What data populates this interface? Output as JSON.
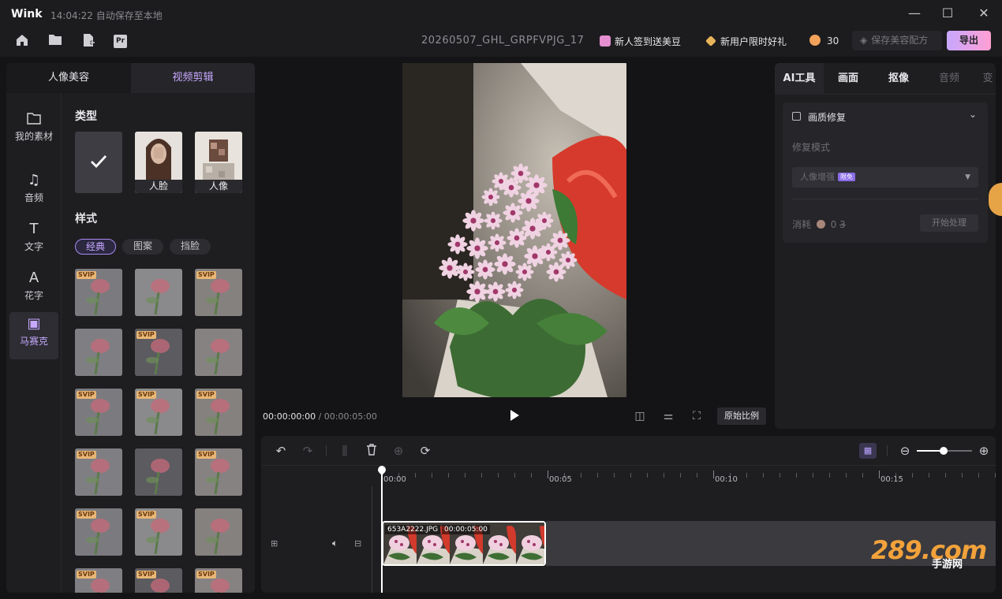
{
  "app": {
    "brand": "Wink",
    "save_status": "14:04:22 自动保存至本地",
    "file_name": "20260507_GHL_GRPFVPJG_17",
    "window": {
      "minimize": "—",
      "maximize": "☐",
      "close": "✕"
    }
  },
  "toolbar": {
    "icons": [
      "home-icon",
      "folder-icon",
      "new-file-icon",
      "premiere-icon"
    ],
    "premiere_label": "Pr",
    "promo_signin": "新人签到送美豆",
    "promo_newuser": "新用户限时好礼",
    "credit_count": "30",
    "save_config": "保存美容配方",
    "export": "导出"
  },
  "left_panel": {
    "tabs": [
      "人像美容",
      "视频剪辑"
    ],
    "nav": [
      {
        "label": "我的素材",
        "icon": "folder-icon",
        "glyph": "🗀"
      },
      {
        "label": "音频",
        "icon": "music-icon",
        "glyph": "♫"
      },
      {
        "label": "文字",
        "icon": "text-icon",
        "glyph": "T"
      },
      {
        "label": "花字",
        "icon": "fancy-text-icon",
        "glyph": "A"
      },
      {
        "label": "马赛克",
        "icon": "mosaic-icon",
        "glyph": "▣"
      }
    ],
    "type_title": "类型",
    "types": [
      "人脸",
      "人像"
    ],
    "style_title": "样式",
    "style_tabs": [
      "经典",
      "图案",
      "挡脸"
    ],
    "svip_badge": "SVIP",
    "tiles_svip": [
      true,
      false,
      true,
      false,
      true,
      false,
      true,
      true,
      true,
      true,
      false,
      true,
      true,
      true,
      false,
      true,
      true,
      true
    ]
  },
  "preview": {
    "time_current": "00:00:00:00",
    "time_total": "/ 00:00:05:00",
    "ratio_button": "原始比例"
  },
  "right_panel": {
    "tabs": [
      "AI工具",
      "画面",
      "抠像",
      "音频",
      "变"
    ],
    "quality_title": "画质修复",
    "repair_mode_label": "修复模式",
    "repair_mode_value": "人像增强",
    "free_badge": "限免",
    "cost_label": "消耗",
    "cost_value": "0",
    "cost_old": "3",
    "start_button": "开始处理"
  },
  "timeline": {
    "ticks": [
      "00:00",
      "00:05",
      "00:10",
      "00:15"
    ],
    "clip_name": "653A2222.JPG",
    "clip_duration": "00:00:05:00",
    "watermark": "289.com",
    "watermark_sub": "手游网"
  }
}
